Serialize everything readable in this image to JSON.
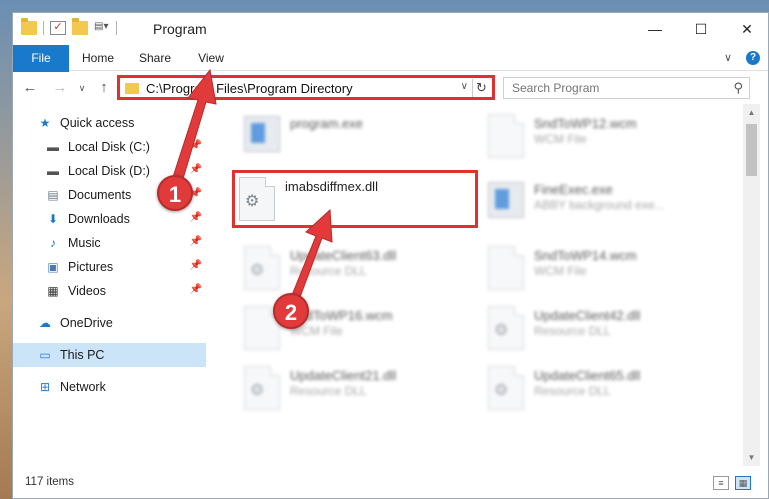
{
  "window": {
    "title": "Program"
  },
  "ribbon": {
    "tabs": [
      "File",
      "Home",
      "Share",
      "View"
    ]
  },
  "address": {
    "path": "C:\\Program Files\\Program Directory"
  },
  "search": {
    "placeholder": "Search Program"
  },
  "nav": {
    "items": [
      {
        "label": "Quick access",
        "icon": "star-icon",
        "pinned": false
      },
      {
        "label": "Local Disk (C:)",
        "icon": "drive-icon",
        "pinned": true
      },
      {
        "label": "Local Disk (D:)",
        "icon": "drive-icon",
        "pinned": true
      },
      {
        "label": "Documents",
        "icon": "documents-icon",
        "pinned": true
      },
      {
        "label": "Downloads",
        "icon": "downloads-icon",
        "pinned": true
      },
      {
        "label": "Music",
        "icon": "music-icon",
        "pinned": true
      },
      {
        "label": "Pictures",
        "icon": "pictures-icon",
        "pinned": true
      },
      {
        "label": "Videos",
        "icon": "videos-icon",
        "pinned": true
      },
      {
        "label": "OneDrive",
        "icon": "cloud-icon",
        "pinned": false
      },
      {
        "label": "This PC",
        "icon": "pc-icon",
        "pinned": false,
        "selected": true
      },
      {
        "label": "Network",
        "icon": "network-icon",
        "pinned": false
      }
    ]
  },
  "files": [
    {
      "name": "program.exe",
      "type": ""
    },
    {
      "name": "SndToWP12.wcm",
      "type": "WCM File"
    },
    {
      "name": "imabsdiffmex.dll",
      "type": ""
    },
    {
      "name": "FineExec.exe",
      "type": "ABBY background exe..."
    },
    {
      "name": "UpdateClient63.dll",
      "type": "Resource DLL"
    },
    {
      "name": "SndToWP14.wcm",
      "type": "WCM File"
    },
    {
      "name": "SndToWP16.wcm",
      "type": "WCM File"
    },
    {
      "name": "UpdateClient42.dll",
      "type": "Resource DLL"
    },
    {
      "name": "UpdateClient21.dll",
      "type": "Resource DLL"
    },
    {
      "name": "UpdateClient65.dll",
      "type": "Resource DLL"
    }
  ],
  "status": {
    "count": "117 items"
  },
  "callouts": [
    "1",
    "2"
  ],
  "colors": {
    "accent": "#1979ca",
    "highlight": "#e03030"
  }
}
